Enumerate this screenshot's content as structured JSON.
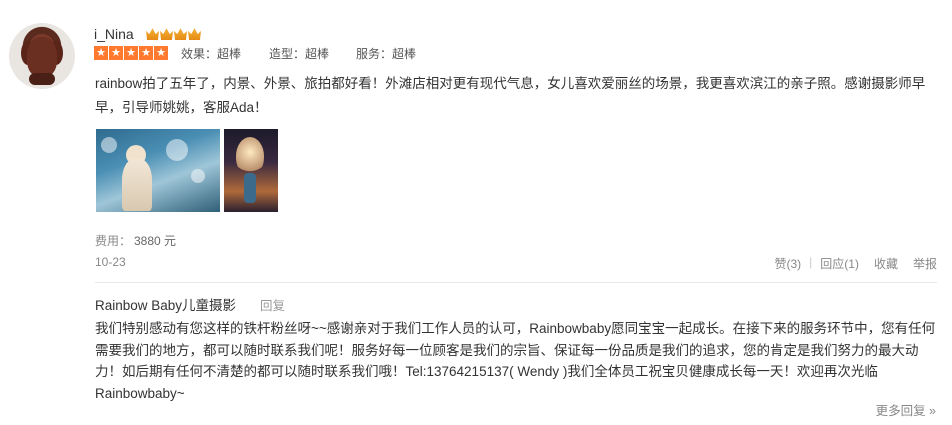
{
  "review": {
    "username": "i_Nina",
    "crown_count": 4,
    "star_count": 5,
    "ratings": [
      {
        "label": "效果：超棒"
      },
      {
        "label": "造型：超棒"
      },
      {
        "label": "服务：超棒"
      }
    ],
    "text": "rainbow拍了五年了，内景、外景、旅拍都好看！外滩店相对更有现代气息，女儿喜欢爱丽丝的场景，我更喜欢滨江的亲子照。感谢摄影师早早，引导师姚姚，客服Ada！",
    "fee_label": "费用：",
    "fee_value": "3880 元",
    "date": "10-23",
    "actions": {
      "like": "赞(3)",
      "reply": "回应(1)",
      "favorite": "收藏",
      "report": "举报"
    }
  },
  "merchant_reply": {
    "name": "Rainbow Baby儿童摄影",
    "reply_label": "回复",
    "text": "我们特别感动有您这样的铁杆粉丝呀~~感谢亲对于我们工作人员的认可，Rainbowbaby愿同宝宝一起成长。在接下来的服务环节中，您有任何需要我们的地方，都可以随时联系我们呢！服务好每一位顾客是我们的宗旨、保证每一份品质是我们的追求，您的肯定是我们努力的最大动力！如后期有任何不清楚的都可以随时联系我们哦！Tel:13764215137( Wendy )我们全体员工祝宝贝健康成长每一天！欢迎再次光临Rainbowbaby~",
    "more": "更多回复 »"
  },
  "colors": {
    "star": "#ff7a2e",
    "crown": "#f0a020"
  }
}
